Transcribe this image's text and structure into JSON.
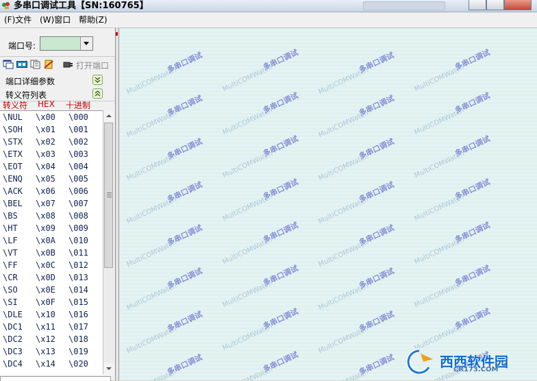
{
  "window": {
    "title": "多串口调试工具【SN:160765】"
  },
  "menu": [
    {
      "label": "(F)文件"
    },
    {
      "label": "(W)窗口"
    },
    {
      "label": "帮助(Z)"
    }
  ],
  "port": {
    "label": "端口号:",
    "value": ""
  },
  "toolbar": {
    "open_port_label": "打开端口"
  },
  "sections": {
    "detail_params": "端口详细参数",
    "escape_table": "转义符列表"
  },
  "columns": {
    "escape": "转义符",
    "hex": "HEX",
    "decimal": "十进制"
  },
  "rows": [
    {
      "esc": "\\NUL",
      "hex": "\\x00",
      "dec": "\\000"
    },
    {
      "esc": "\\SOH",
      "hex": "\\x01",
      "dec": "\\001"
    },
    {
      "esc": "\\STX",
      "hex": "\\x02",
      "dec": "\\002"
    },
    {
      "esc": "\\ETX",
      "hex": "\\x03",
      "dec": "\\003"
    },
    {
      "esc": "\\EOT",
      "hex": "\\x04",
      "dec": "\\004"
    },
    {
      "esc": "\\ENQ",
      "hex": "\\x05",
      "dec": "\\005"
    },
    {
      "esc": "\\ACK",
      "hex": "\\x06",
      "dec": "\\006"
    },
    {
      "esc": "\\BEL",
      "hex": "\\x07",
      "dec": "\\007"
    },
    {
      "esc": "\\BS",
      "hex": "\\x08",
      "dec": "\\008"
    },
    {
      "esc": "\\HT",
      "hex": "\\x09",
      "dec": "\\009"
    },
    {
      "esc": "\\LF",
      "hex": "\\x0A",
      "dec": "\\010"
    },
    {
      "esc": "\\VT",
      "hex": "\\x0B",
      "dec": "\\011"
    },
    {
      "esc": "\\FF",
      "hex": "\\x0C",
      "dec": "\\012"
    },
    {
      "esc": "\\CR",
      "hex": "\\x0D",
      "dec": "\\013"
    },
    {
      "esc": "\\SO",
      "hex": "\\x0E",
      "dec": "\\014"
    },
    {
      "esc": "\\SI",
      "hex": "\\x0F",
      "dec": "\\015"
    },
    {
      "esc": "\\DLE",
      "hex": "\\x10",
      "dec": "\\016"
    },
    {
      "esc": "\\DC1",
      "hex": "\\x11",
      "dec": "\\017"
    },
    {
      "esc": "\\DC2",
      "hex": "\\x12",
      "dec": "\\018"
    },
    {
      "esc": "\\DC3",
      "hex": "\\x13",
      "dec": "\\019"
    },
    {
      "esc": "\\DC4",
      "hex": "\\x14",
      "dec": "\\020"
    }
  ],
  "watermark": {
    "cn": "多串口调试",
    "en": "MultiCOMWatch"
  },
  "logo": {
    "text": "西西软件园",
    "sub": "CR173.COM"
  },
  "colors": {
    "header_red": "#c00000",
    "port_field_green": "#c9e8cf",
    "display_bg": "#cde7e6"
  }
}
